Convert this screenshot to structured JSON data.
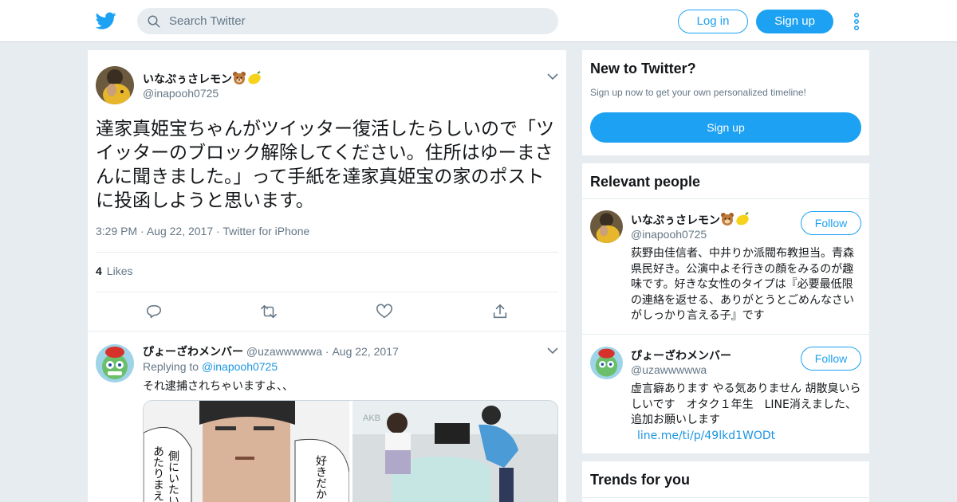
{
  "header": {
    "search_placeholder": "Search Twitter",
    "login_label": "Log in",
    "signup_label": "Sign up",
    "brand_color": "#1da1f2"
  },
  "tweet": {
    "author_name": "いなぷぅさレモン",
    "author_emojis": [
      "bear-face",
      "lemon"
    ],
    "author_handle": "@inapooh0725",
    "text": "達家真姫宝ちゃんがツイッター復活したらしいので「ツイッターのブロック解除してください。住所はゆーまさんに聞きました。」って手紙を達家真姫宝の家のポストに投函しようと思います。",
    "time": "3:29 PM",
    "date": "Aug 22, 2017",
    "source": "Twitter for iPhone",
    "likes_count": "4",
    "likes_label": "Likes"
  },
  "reply": {
    "author_name": "ぴょーざわメンバー",
    "author_handle": "@uzawwwwwa",
    "date": "Aug 22, 2017",
    "replying_prefix": "Replying to",
    "replying_handle": "@inapooh0725",
    "text": "それ逮捕されちゃいますよ、、",
    "media_left_lines": [
      "側にいたい",
      "あたりまえ",
      "好きだか"
    ],
    "media_right_sign": "AKB"
  },
  "sidebar": {
    "new_title": "New to Twitter?",
    "new_subtitle": "Sign up now to get your own personalized timeline!",
    "signup_label": "Sign up",
    "relevant_title": "Relevant people",
    "people": [
      {
        "name": "いなぷぅさレモン",
        "handle": "@inapooh0725",
        "follow_label": "Follow",
        "bio": "荻野由佳信者、中井りか派閥布教担当。青森県民好き。公演中よそ行きの顔をみるのが趣味です。好きな女性のタイプは『必要最低限の連絡を返せる、ありがとうとごめんなさいがしっかり言える子』です",
        "link": ""
      },
      {
        "name": "ぴょーざわメンバー",
        "handle": "@uzawwwwwa",
        "follow_label": "Follow",
        "bio": "虚言癖あります やる気ありません 胡散臭いらしいです　オタク１年生　LINE消えました、追加お願いします",
        "link": "line.me/ti/p/49lkd1WODt"
      }
    ],
    "trends_title": "Trends for you"
  }
}
